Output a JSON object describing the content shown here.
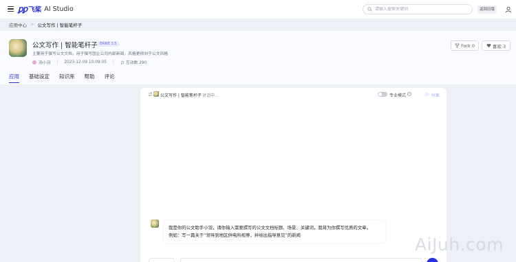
{
  "topbar": {
    "logo_mark": "飞桨",
    "logo_cn": "飞桨",
    "logo_text": "AI Studio",
    "search_placeholder": "请输入搜索关键词",
    "return_label": "返回旧版"
  },
  "breadcrumb": {
    "root": "应用中心",
    "separator": ">",
    "current": "公文写作 | 智能笔杆子"
  },
  "app": {
    "title": "公文写作 | 智能笔杆子",
    "model_badge": "ERNIE 3.5",
    "description": "主要用于撰写公文文档，用于撰写国企公司内部新闻，风格更倾向于公文风格",
    "author": "汤小羽",
    "datetime": "2023-12-09 10:09:05",
    "interactions": "互动数 290",
    "fork_label": "Fork 0",
    "like_label": "喜欢 3"
  },
  "tabs": [
    {
      "label": "应用",
      "active": true
    },
    {
      "label": "基础设定",
      "active": false
    },
    {
      "label": "知识库",
      "active": false
    },
    {
      "label": "帮助",
      "active": false
    },
    {
      "label": "评论",
      "active": false
    }
  ],
  "chat": {
    "name": "公文写作 | 智能笔杆子",
    "status": "对话中...",
    "pro_mode_label": "专业模式",
    "pro_mode_on": false,
    "share_label": "分享",
    "greeting_line1": "我是你的公文助手小羽，请你输入需要撰写的公文文档标题、场景、关键词，我将为你撰写优质的文章。",
    "greeting_line2": "例如：写一篇关于“领导到地区供电所视察，并给出指导意见”的新闻"
  },
  "watermark": "AiJuh.com",
  "colors": {
    "brand": "#2932e1",
    "page_bg": "#eef0f8"
  }
}
